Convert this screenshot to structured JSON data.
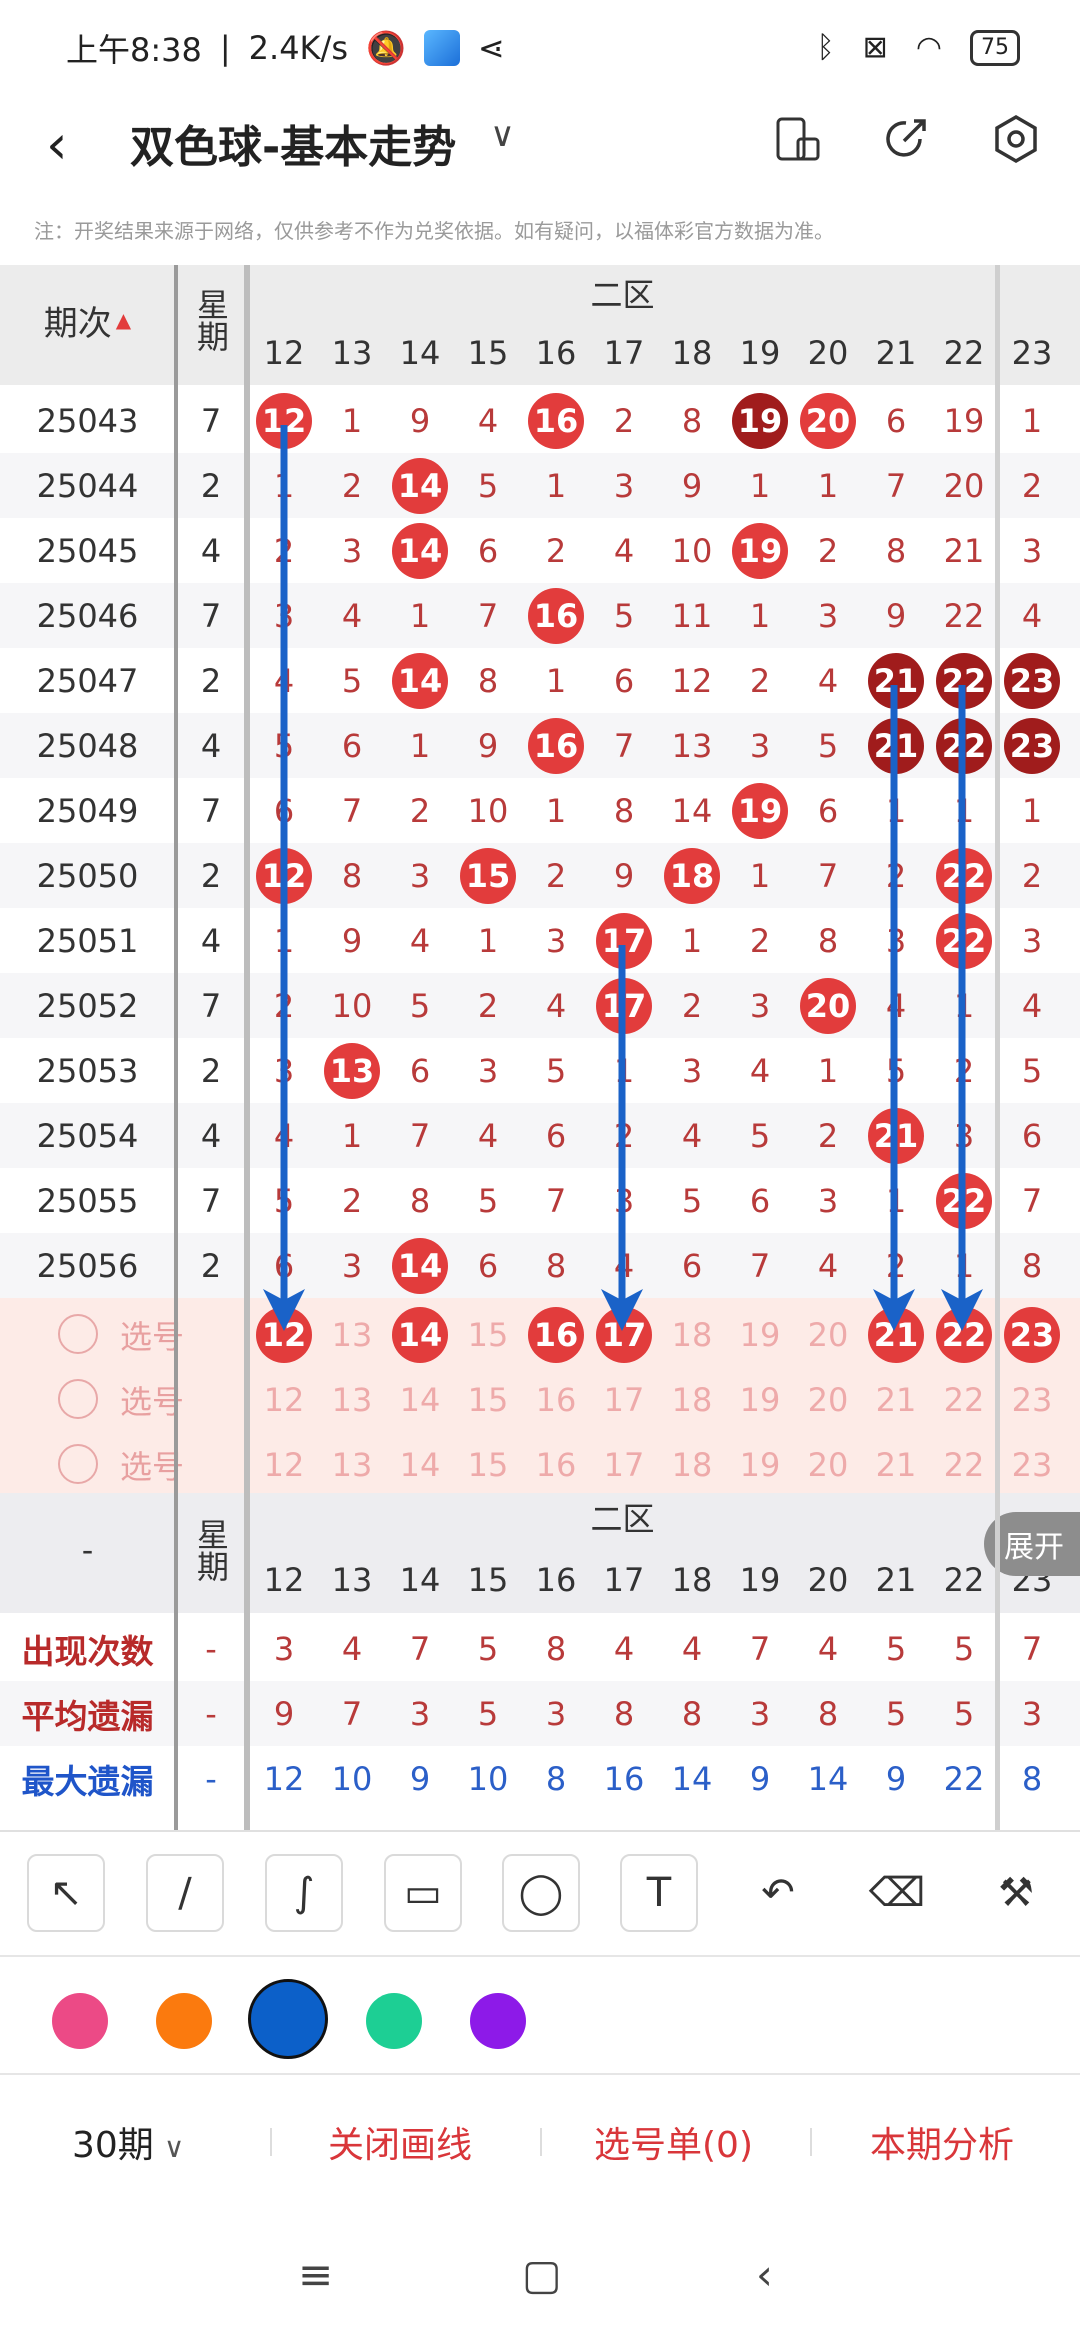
{
  "status_bar": {
    "time": "上午8:38",
    "speed": "2.4K/s",
    "battery": "75"
  },
  "header": {
    "title": "双色球-基本走势"
  },
  "notice": "注：开奖结果来源于网络，仅供参考不作为兑奖依据。如有疑问，以福体彩官方数据为准。",
  "table": {
    "period_header": "期次",
    "week_header": "星期",
    "zone_header": "二区",
    "columns": [
      "12",
      "13",
      "14",
      "15",
      "16",
      "17",
      "18",
      "19",
      "20",
      "21",
      "22",
      "23"
    ],
    "rows": [
      {
        "period": "25043",
        "week": "7",
        "cells": [
          "12",
          "1",
          "9",
          "4",
          "16",
          "2",
          "8",
          "19",
          "20",
          "6",
          "19",
          "1"
        ],
        "balls": [
          0,
          4,
          7,
          8
        ],
        "dark": [
          7
        ]
      },
      {
        "period": "25044",
        "week": "2",
        "cells": [
          "1",
          "2",
          "14",
          "5",
          "1",
          "3",
          "9",
          "1",
          "1",
          "7",
          "20",
          "2"
        ],
        "balls": [
          2
        ],
        "dark": []
      },
      {
        "period": "25045",
        "week": "4",
        "cells": [
          "2",
          "3",
          "14",
          "6",
          "2",
          "4",
          "10",
          "19",
          "2",
          "8",
          "21",
          "3"
        ],
        "balls": [
          2,
          7
        ],
        "dark": []
      },
      {
        "period": "25046",
        "week": "7",
        "cells": [
          "3",
          "4",
          "1",
          "7",
          "16",
          "5",
          "11",
          "1",
          "3",
          "9",
          "22",
          "4"
        ],
        "balls": [
          4
        ],
        "dark": []
      },
      {
        "period": "25047",
        "week": "2",
        "cells": [
          "4",
          "5",
          "14",
          "8",
          "1",
          "6",
          "12",
          "2",
          "4",
          "21",
          "22",
          "23"
        ],
        "balls": [
          2,
          9,
          10,
          11
        ],
        "dark": [
          9,
          10,
          11
        ]
      },
      {
        "period": "25048",
        "week": "4",
        "cells": [
          "5",
          "6",
          "1",
          "9",
          "16",
          "7",
          "13",
          "3",
          "5",
          "21",
          "22",
          "23"
        ],
        "balls": [
          4,
          9,
          10,
          11
        ],
        "dark": [
          9,
          10,
          11
        ]
      },
      {
        "period": "25049",
        "week": "7",
        "cells": [
          "6",
          "7",
          "2",
          "10",
          "1",
          "8",
          "14",
          "19",
          "6",
          "1",
          "1",
          "1"
        ],
        "balls": [
          7
        ],
        "dark": []
      },
      {
        "period": "25050",
        "week": "2",
        "cells": [
          "12",
          "8",
          "3",
          "15",
          "2",
          "9",
          "18",
          "1",
          "7",
          "2",
          "22",
          "2"
        ],
        "balls": [
          0,
          3,
          6,
          10
        ],
        "dark": []
      },
      {
        "period": "25051",
        "week": "4",
        "cells": [
          "1",
          "9",
          "4",
          "1",
          "3",
          "17",
          "1",
          "2",
          "8",
          "3",
          "22",
          "3"
        ],
        "balls": [
          5,
          10
        ],
        "dark": []
      },
      {
        "period": "25052",
        "week": "7",
        "cells": [
          "2",
          "10",
          "5",
          "2",
          "4",
          "17",
          "2",
          "3",
          "20",
          "4",
          "1",
          "4"
        ],
        "balls": [
          5,
          8
        ],
        "dark": []
      },
      {
        "period": "25053",
        "week": "2",
        "cells": [
          "3",
          "13",
          "6",
          "3",
          "5",
          "1",
          "3",
          "4",
          "1",
          "5",
          "2",
          "5"
        ],
        "balls": [
          1
        ],
        "dark": []
      },
      {
        "period": "25054",
        "week": "4",
        "cells": [
          "4",
          "1",
          "7",
          "4",
          "6",
          "2",
          "4",
          "5",
          "2",
          "21",
          "3",
          "6"
        ],
        "balls": [
          9
        ],
        "dark": []
      },
      {
        "period": "25055",
        "week": "7",
        "cells": [
          "5",
          "2",
          "8",
          "5",
          "7",
          "3",
          "5",
          "6",
          "3",
          "1",
          "22",
          "7"
        ],
        "balls": [
          10
        ],
        "dark": []
      },
      {
        "period": "25056",
        "week": "2",
        "cells": [
          "6",
          "3",
          "14",
          "6",
          "8",
          "4",
          "6",
          "7",
          "4",
          "2",
          "1",
          "8"
        ],
        "balls": [
          2
        ],
        "dark": []
      }
    ],
    "pick_label": "选号",
    "pick_rows": [
      {
        "balls": [
          0,
          2,
          4,
          5,
          9,
          10,
          11
        ]
      },
      {
        "balls": []
      },
      {
        "balls": []
      }
    ]
  },
  "stats": {
    "dash": "-",
    "rows": [
      {
        "label": "出现次数",
        "type": "red",
        "week": "-",
        "values": [
          "3",
          "4",
          "7",
          "5",
          "8",
          "4",
          "4",
          "7",
          "4",
          "5",
          "5",
          "7"
        ]
      },
      {
        "label": "平均遗漏",
        "type": "red",
        "week": "-",
        "values": [
          "9",
          "7",
          "3",
          "5",
          "3",
          "8",
          "8",
          "3",
          "8",
          "5",
          "5",
          "3"
        ]
      },
      {
        "label": "最大遗漏",
        "type": "blue",
        "week": "-",
        "values": [
          "12",
          "10",
          "9",
          "10",
          "8",
          "16",
          "14",
          "9",
          "14",
          "9",
          "22",
          "8"
        ]
      }
    ]
  },
  "expand_label": "展开",
  "tools": [
    "arrow-tool",
    "line-tool",
    "curve-tool",
    "rect-tool",
    "circle-tool",
    "text-tool",
    "undo-tool",
    "eraser-tool",
    "clear-tool"
  ],
  "colors": [
    "#ec4a86",
    "#fb7a0e",
    "#0c60c9",
    "#1dcf94",
    "#8d1ae8"
  ],
  "bottom_bar": {
    "periods": "30期",
    "close_drawing": "关闭画线",
    "pick_list": "选号单(0)",
    "analysis": "本期分析"
  }
}
